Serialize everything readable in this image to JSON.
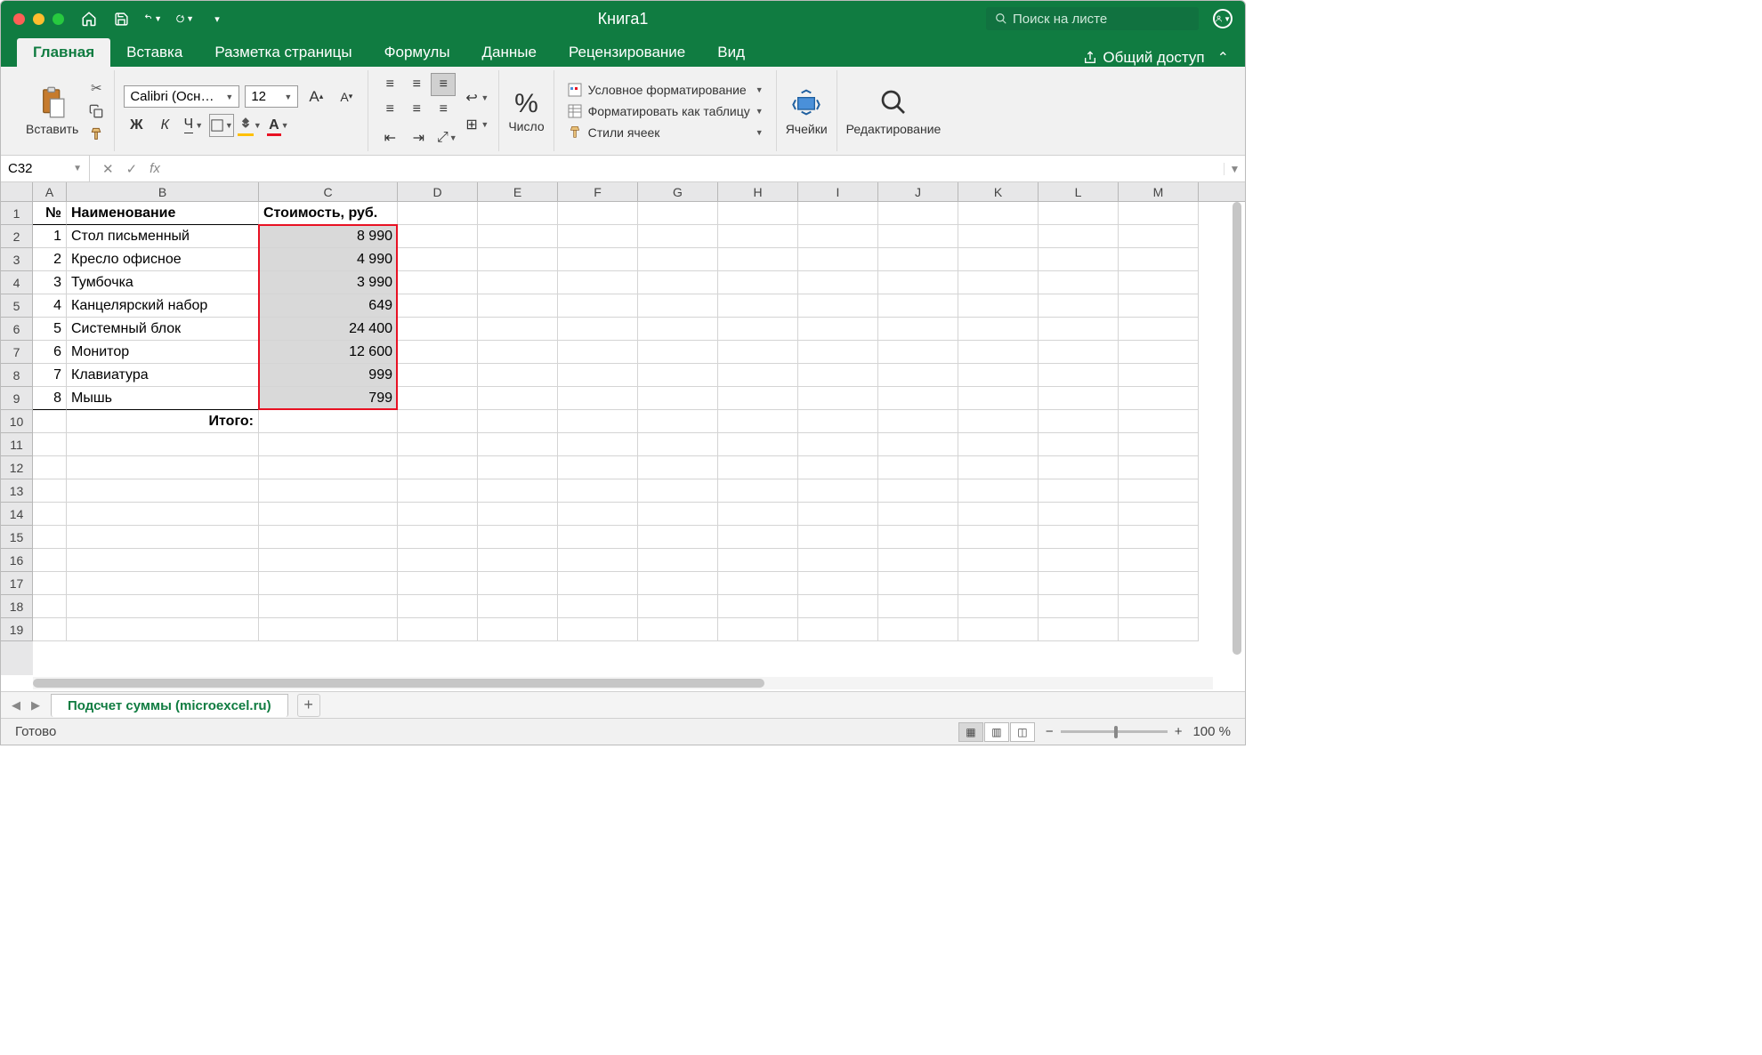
{
  "title": "Книга1",
  "search_placeholder": "Поиск на листе",
  "tabs": [
    "Главная",
    "Вставка",
    "Разметка страницы",
    "Формулы",
    "Данные",
    "Рецензирование",
    "Вид"
  ],
  "active_tab": 0,
  "share_label": "Общий доступ",
  "paste_label": "Вставить",
  "font_name": "Calibri (Осн…",
  "font_size": "12",
  "number_label": "Число",
  "cond_fmt": "Условное форматирование",
  "fmt_table": "Форматировать как таблицу",
  "cell_styles": "Стили ячеек",
  "cells_label": "Ячейки",
  "editing_label": "Редактирование",
  "name_box": "C32",
  "columns": [
    "A",
    "B",
    "C",
    "D",
    "E",
    "F",
    "G",
    "H",
    "I",
    "J",
    "K",
    "L",
    "M"
  ],
  "visible_rows": 19,
  "headers": {
    "A": "№",
    "B": "Наименование",
    "C": "Стоимость, руб."
  },
  "data_rows": [
    {
      "n": "1",
      "name": "Стол письменный",
      "price": "8 990"
    },
    {
      "n": "2",
      "name": "Кресло офисное",
      "price": "4 990"
    },
    {
      "n": "3",
      "name": "Тумбочка",
      "price": "3 990"
    },
    {
      "n": "4",
      "name": "Канцелярский набор",
      "price": "649"
    },
    {
      "n": "5",
      "name": "Системный блок",
      "price": "24 400"
    },
    {
      "n": "6",
      "name": "Монитор",
      "price": "12 600"
    },
    {
      "n": "7",
      "name": "Клавиатура",
      "price": "999"
    },
    {
      "n": "8",
      "name": "Мышь",
      "price": "799"
    }
  ],
  "total_label": "Итого:",
  "sheet_name": "Подсчет суммы (microexcel.ru)",
  "status_text": "Готово",
  "zoom_label": "100 %"
}
